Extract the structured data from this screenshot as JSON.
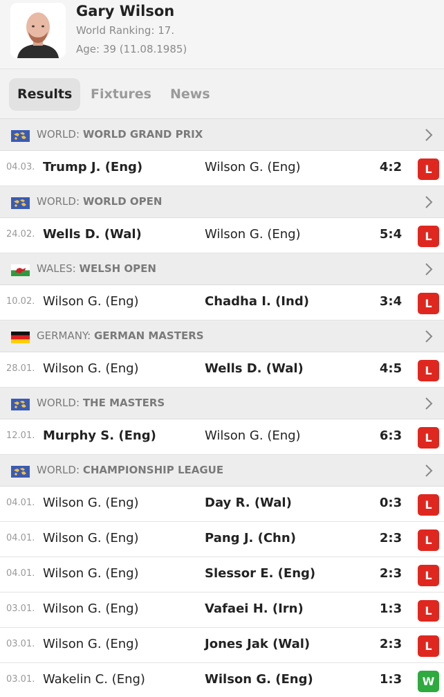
{
  "player": {
    "name": "Gary Wilson",
    "ranking": "World Ranking: 17.",
    "age": "Age: 39 (11.08.1985)"
  },
  "tabs": [
    {
      "label": "Results",
      "active": true
    },
    {
      "label": "Fixtures",
      "active": false
    },
    {
      "label": "News",
      "active": false
    }
  ],
  "colors": {
    "loss": "#e0271f",
    "win": "#2eaa3f",
    "world_flag": "#3a5bb5"
  },
  "sections": [
    {
      "country": "WORLD:",
      "competition": "WORLD GRAND PRIX",
      "flag": "world-flag-icon",
      "matches": [
        {
          "date": "04.03.",
          "home": "Trump J. (Eng)",
          "away": "Wilson G. (Eng)",
          "winner": "home",
          "score": "4:2",
          "result": "L"
        }
      ]
    },
    {
      "country": "WORLD:",
      "competition": "WORLD OPEN",
      "flag": "world-flag-icon",
      "matches": [
        {
          "date": "24.02.",
          "home": "Wells D. (Wal)",
          "away": "Wilson G. (Eng)",
          "winner": "home",
          "score": "5:4",
          "result": "L"
        }
      ]
    },
    {
      "country": "WALES:",
      "competition": "WELSH OPEN",
      "flag": "wales-flag-icon",
      "matches": [
        {
          "date": "10.02.",
          "home": "Wilson G. (Eng)",
          "away": "Chadha I. (Ind)",
          "winner": "away",
          "score": "3:4",
          "result": "L"
        }
      ]
    },
    {
      "country": "GERMANY:",
      "competition": "GERMAN MASTERS",
      "flag": "germany-flag-icon",
      "matches": [
        {
          "date": "28.01.",
          "home": "Wilson G. (Eng)",
          "away": "Wells D. (Wal)",
          "winner": "away",
          "score": "4:5",
          "result": "L"
        }
      ]
    },
    {
      "country": "WORLD:",
      "competition": "THE MASTERS",
      "flag": "world-flag-icon",
      "matches": [
        {
          "date": "12.01.",
          "home": "Murphy S. (Eng)",
          "away": "Wilson G. (Eng)",
          "winner": "home",
          "score": "6:3",
          "result": "L"
        }
      ]
    },
    {
      "country": "WORLD:",
      "competition": "CHAMPIONSHIP LEAGUE",
      "flag": "world-flag-icon",
      "matches": [
        {
          "date": "04.01.",
          "home": "Wilson G. (Eng)",
          "away": "Day R. (Wal)",
          "winner": "away",
          "score": "0:3",
          "result": "L"
        },
        {
          "date": "04.01.",
          "home": "Wilson G. (Eng)",
          "away": "Pang J. (Chn)",
          "winner": "away",
          "score": "2:3",
          "result": "L"
        },
        {
          "date": "04.01.",
          "home": "Wilson G. (Eng)",
          "away": "Slessor E. (Eng)",
          "winner": "away",
          "score": "2:3",
          "result": "L"
        },
        {
          "date": "03.01.",
          "home": "Wilson G. (Eng)",
          "away": "Vafaei H. (Irn)",
          "winner": "away",
          "score": "1:3",
          "result": "L"
        },
        {
          "date": "03.01.",
          "home": "Wilson G. (Eng)",
          "away": "Jones Jak (Wal)",
          "winner": "away",
          "score": "2:3",
          "result": "L"
        },
        {
          "date": "03.01.",
          "home": "Wakelin C. (Eng)",
          "away": "Wilson G. (Eng)",
          "winner": "away",
          "score": "1:3",
          "result": "W"
        }
      ]
    }
  ]
}
